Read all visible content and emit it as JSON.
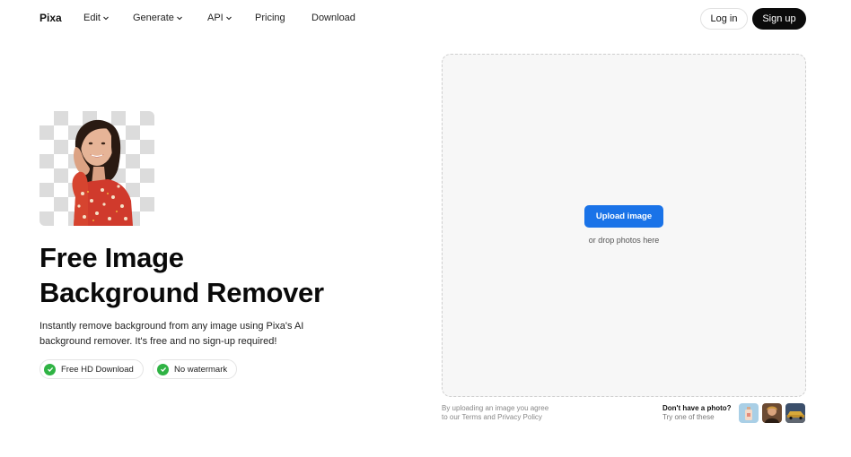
{
  "nav": {
    "logo": "Pixa",
    "items": [
      {
        "label": "Edit",
        "dropdown": true
      },
      {
        "label": "Generate",
        "dropdown": true
      },
      {
        "label": "API",
        "dropdown": true
      },
      {
        "label": "Pricing",
        "dropdown": false
      },
      {
        "label": "Download",
        "dropdown": false
      }
    ],
    "login": "Log in",
    "signup": "Sign up"
  },
  "hero": {
    "headline_line1": "Free Image",
    "headline_line2": "Background Remover",
    "subtext": "Instantly remove background from any image using Pixa's AI background remover. It's free and no sign-up required!",
    "badges": [
      "Free HD Download",
      "No watermark"
    ]
  },
  "upload": {
    "button": "Upload image",
    "drop_text": "or drop photos here",
    "terms_line1": "By uploading an image you agree",
    "terms_line2": "to our Terms and Privacy Policy",
    "no_photo_title": "Don't have a photo?",
    "no_photo_sub": "Try one of these"
  },
  "colors": {
    "accent": "#1a73e8",
    "check": "#2fb344",
    "signup_bg": "#0b0b0b"
  }
}
